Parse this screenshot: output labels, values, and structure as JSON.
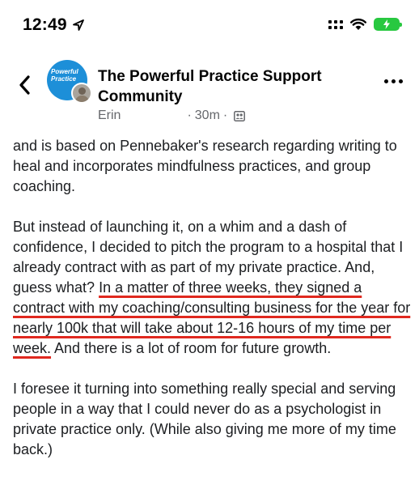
{
  "status_bar": {
    "time": "12:49",
    "location_icon": "location-arrow-icon",
    "signal_icon": "signal-dots-icon",
    "wifi_icon": "wifi-icon",
    "battery_icon": "battery-charging-icon",
    "battery_color": "#28c840"
  },
  "header": {
    "back_icon": "chevron-left-icon",
    "group_avatar_text": "Powerful Practice",
    "group_name": "The Powerful Practice Support Community",
    "author": "Erin",
    "time_ago": "30m",
    "separator": "·",
    "audience_icon": "members-icon",
    "more_icon": "more-horizontal-icon"
  },
  "post": {
    "paragraph1": "and is based on Pennebaker's research regarding writing to heal and incorporates mindfulness practices, and group coaching.",
    "paragraph2_before": "But instead of launching it, on a whim and a dash of confidence, I decided to pitch the program to a hospital that I already contract with as part of my private practice.  And, guess what? ",
    "paragraph2_highlight": "In a matter of three weeks, they signed a contract with my coaching/consulting business for the year for nearly 100k that will take about 12-16 hours of my time per week.",
    "paragraph2_after": " And there is a lot of room for future growth.",
    "paragraph3": "I foresee it turning into something really special and serving people in a way that I could never do as a psychologist in private practice only. (While also giving me more of my time back.)",
    "highlight_color": "#e0291f"
  }
}
